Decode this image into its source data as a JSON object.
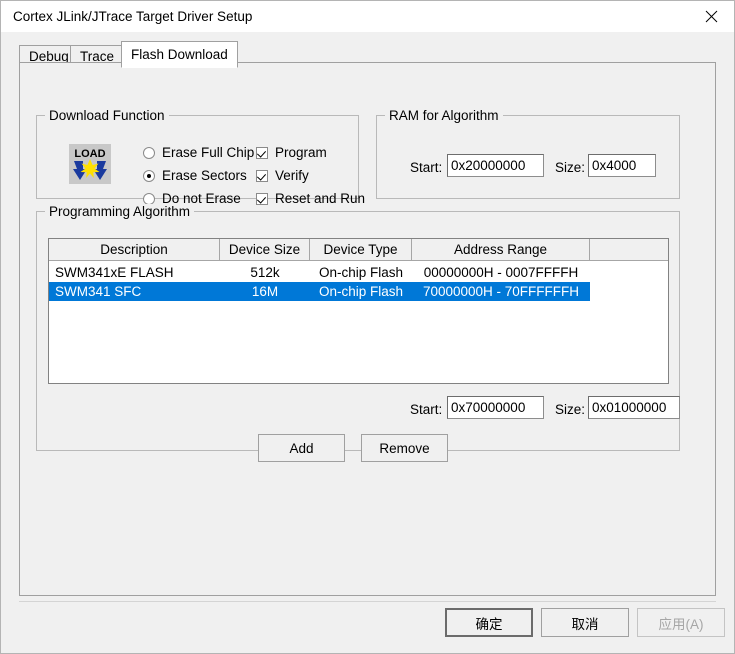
{
  "window": {
    "title": "Cortex JLink/JTrace Target Driver Setup",
    "close_icon": "close-icon"
  },
  "tabs": [
    {
      "label": "Debug",
      "active": false
    },
    {
      "label": "Trace",
      "active": false
    },
    {
      "label": "Flash Download",
      "active": true
    }
  ],
  "download_function": {
    "title": "Download Function",
    "icon": "load-icon",
    "icon_text": "LOAD",
    "radios": [
      {
        "label": "Erase Full Chip",
        "checked": false
      },
      {
        "label": "Erase Sectors",
        "checked": true
      },
      {
        "label": "Do not Erase",
        "checked": false
      }
    ],
    "checkboxes": [
      {
        "label": "Program",
        "checked": true
      },
      {
        "label": "Verify",
        "checked": true
      },
      {
        "label": "Reset and Run",
        "checked": true
      }
    ]
  },
  "ram_for_algorithm": {
    "title": "RAM for Algorithm",
    "start_label": "Start:",
    "start_value": "0x20000000",
    "size_label": "Size:",
    "size_value": "0x4000"
  },
  "programming_algorithm": {
    "title": "Programming Algorithm",
    "columns": [
      "Description",
      "Device Size",
      "Device Type",
      "Address Range",
      ""
    ],
    "rows": [
      {
        "description": "SWM341xE FLASH",
        "device_size": "512k",
        "device_type": "On-chip Flash",
        "address_range": "00000000H - 0007FFFFH",
        "selected": false
      },
      {
        "description": "SWM341 SFC",
        "device_size": "16M",
        "device_type": "On-chip Flash",
        "address_range": "70000000H - 70FFFFFFH",
        "selected": true
      }
    ],
    "start_label": "Start:",
    "start_value": "0x70000000",
    "size_label": "Size:",
    "size_value": "0x01000000",
    "add_label": "Add",
    "remove_label": "Remove"
  },
  "footer": {
    "ok_label": "确定",
    "cancel_label": "取消",
    "apply_label": "应用(A)",
    "apply_disabled": true
  },
  "colors": {
    "selection": "#0078D7",
    "dialog_bg": "#F0F0F0",
    "field_bg": "#FFFFFF"
  }
}
